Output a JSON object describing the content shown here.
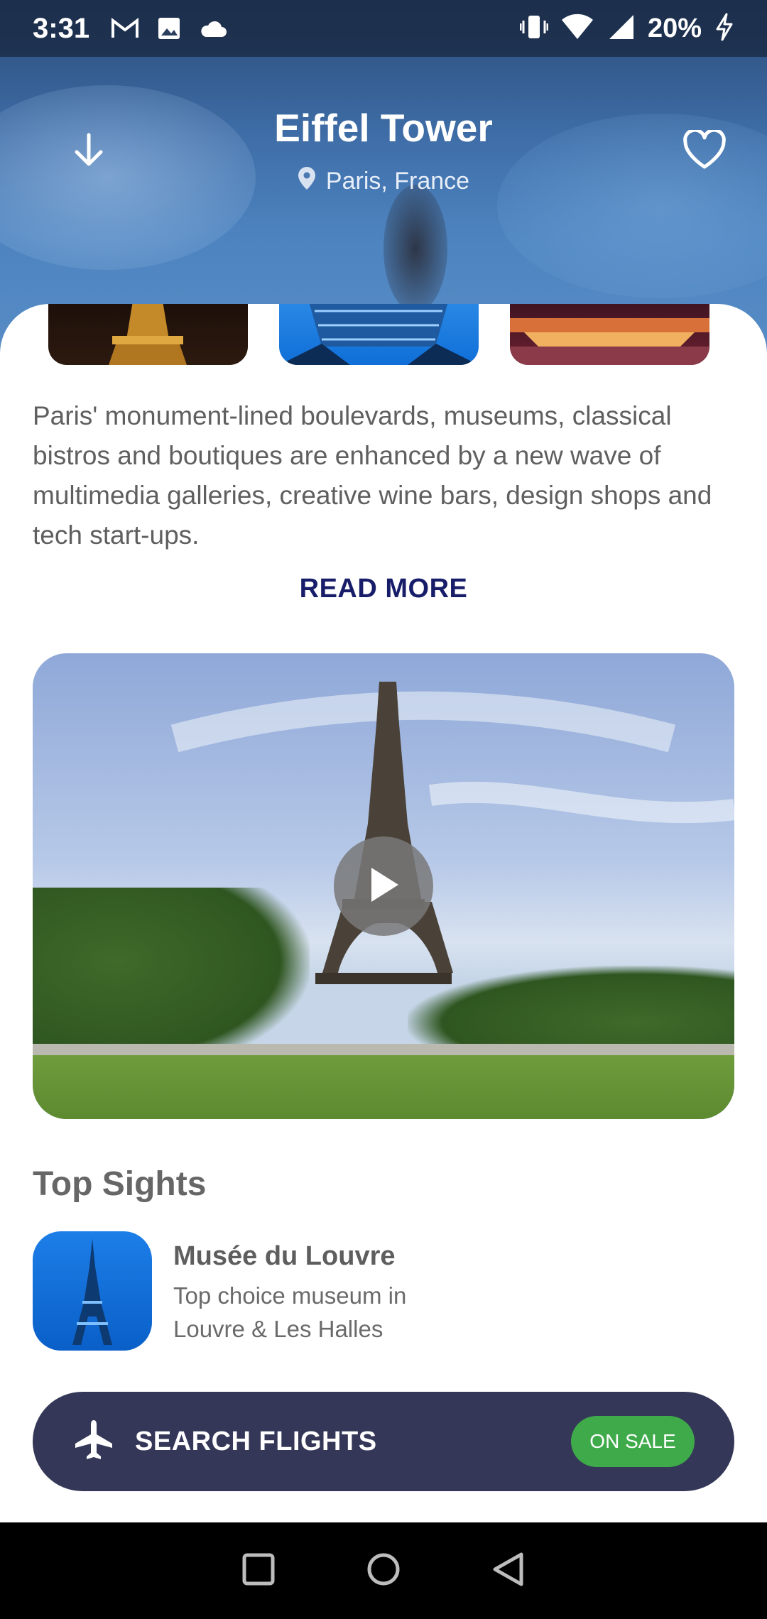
{
  "status_bar": {
    "time": "3:31",
    "battery": "20%",
    "icons": [
      "gmail-icon",
      "image-icon",
      "cloud-icon",
      "vibrate-icon",
      "wifi-icon",
      "signal-icon",
      "charging-icon"
    ]
  },
  "header": {
    "title": "Eiffel Tower",
    "location": "Paris, France",
    "back_icon": "arrow-down-icon",
    "favorite_icon": "heart-outline-icon"
  },
  "gallery": {
    "thumbnails": [
      "eiffel-night",
      "eiffel-blue-sky",
      "paris-river-night"
    ]
  },
  "description": {
    "text": "Paris' monument-lined boulevards, museums, classical bistros and boutiques are enhanced by a new wave of multimedia galleries, creative wine bars, design shops and tech start-ups.",
    "read_more": "READ MORE"
  },
  "video": {
    "play_icon": "play-icon"
  },
  "top_sights": {
    "title": "Top Sights",
    "items": [
      {
        "name": "Musée du Louvre",
        "description_line1": "Top choice museum in",
        "description_line2": "Louvre & Les Halles"
      }
    ]
  },
  "flights": {
    "label": "SEARCH FLIGHTS",
    "badge": "ON SALE",
    "icon": "airplane-icon"
  },
  "colors": {
    "read_more": "#181d6a",
    "flights_bg": "#343757",
    "sale_badge": "#3faa4a"
  }
}
